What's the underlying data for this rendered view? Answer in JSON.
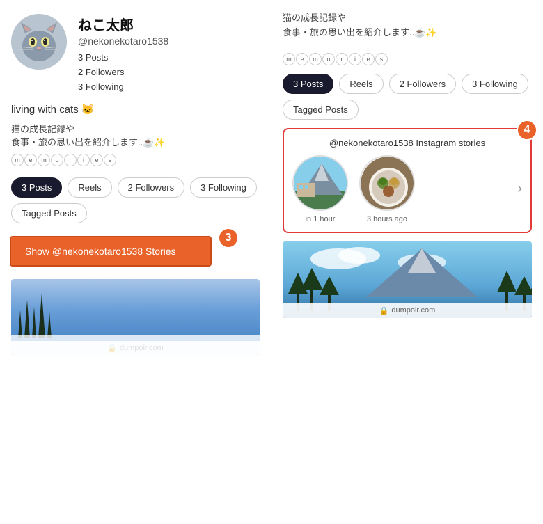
{
  "left": {
    "profile": {
      "name": "ねこ太郎",
      "handle": "@nekonekotaro1538",
      "stats": {
        "posts": "3 Posts",
        "followers": "2 Followers",
        "following": "3 Following"
      }
    },
    "bio": {
      "living": "living with cats 🐱",
      "text": "猫の成長記録や\n食事・旅の思い出を紹介します..☕✨",
      "memories_letters": [
        "m",
        "e",
        "m",
        "o",
        "r",
        "i",
        "e",
        "s"
      ]
    },
    "tabs": [
      {
        "label": "3 Posts",
        "active": true
      },
      {
        "label": "Reels",
        "active": false
      },
      {
        "label": "2 Followers",
        "active": false
      },
      {
        "label": "3 Following",
        "active": false
      },
      {
        "label": "Tagged Posts",
        "active": false
      }
    ],
    "stories_button": "Show @nekonekotaro1538 Stories",
    "badge3": "3",
    "lock_label": "dumpoir.com"
  },
  "right": {
    "bio_text": "猫の成長記録や\n食事・旅の思い出を紹介します..☕✨",
    "memories_letters": [
      "m",
      "e",
      "m",
      "o",
      "r",
      "i",
      "e",
      "s"
    ],
    "tabs": [
      {
        "label": "3 Posts",
        "active": true
      },
      {
        "label": "Reels",
        "active": false
      },
      {
        "label": "2 Followers",
        "active": false
      },
      {
        "label": "3 Following",
        "active": false
      },
      {
        "label": "Tagged Posts",
        "active": false
      }
    ],
    "stories_card": {
      "title": "@nekonekotaro1538 Instagram stories",
      "badge": "4",
      "items": [
        {
          "time": "in 1 hour"
        },
        {
          "time": "3 hours ago"
        }
      ]
    },
    "lock_label": "dumpoir.com"
  }
}
